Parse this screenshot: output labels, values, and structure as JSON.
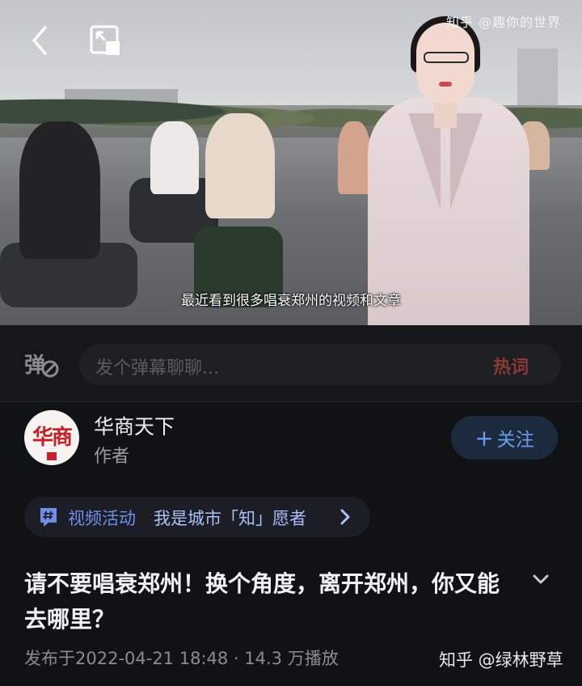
{
  "video": {
    "watermark": "知乎 @趣你的世界",
    "subtitle": "最近看到很多唱衰郑州的视频和文章"
  },
  "danmaku": {
    "placeholder": "发个弹幕聊聊...",
    "hot_words": "热词"
  },
  "author": {
    "avatar_text": "华商",
    "name": "华商天下",
    "role": "作者",
    "follow_label": "关注"
  },
  "activity": {
    "tag": "视频活动",
    "label": "我是城市「知」愿者"
  },
  "post": {
    "title": "请不要唱衰郑州！换个角度，离开郑州，你又能去哪里？",
    "meta": "发布于2022-04-21 18:48 · 14.3 万播放"
  },
  "footer": {
    "watermark": "知乎 @绿林野草"
  },
  "colors": {
    "background": "#111214",
    "accent_blue": "#6c9cf0",
    "hot_words_red": "#8a3a33",
    "avatar_red": "#c2202a"
  }
}
